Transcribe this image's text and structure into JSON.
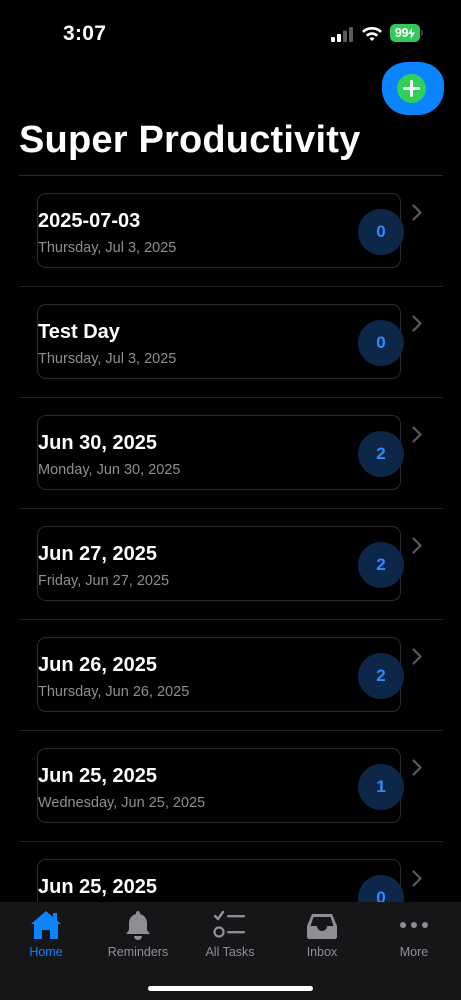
{
  "status_bar": {
    "time": "3:07",
    "battery": "99"
  },
  "header": {
    "title": "Super Productivity"
  },
  "days": [
    {
      "title": "2025-07-03",
      "subtitle": "Thursday, Jul 3, 2025",
      "count": "0"
    },
    {
      "title": "Test Day",
      "subtitle": "Thursday, Jul 3, 2025",
      "count": "0"
    },
    {
      "title": "Jun 30, 2025",
      "subtitle": "Monday, Jun 30, 2025",
      "count": "2"
    },
    {
      "title": "Jun 27, 2025",
      "subtitle": "Friday, Jun 27, 2025",
      "count": "2"
    },
    {
      "title": "Jun 26, 2025",
      "subtitle": "Thursday, Jun 26, 2025",
      "count": "2"
    },
    {
      "title": "Jun 25, 2025",
      "subtitle": "Wednesday, Jun 25, 2025",
      "count": "1"
    },
    {
      "title": "Jun 25, 2025",
      "subtitle": "",
      "count": "0"
    }
  ],
  "tabs": [
    {
      "label": "Home",
      "icon": "house-icon",
      "active": true
    },
    {
      "label": "Reminders",
      "icon": "bell-icon",
      "active": false
    },
    {
      "label": "All Tasks",
      "icon": "checklist-icon",
      "active": false
    },
    {
      "label": "Inbox",
      "icon": "tray-icon",
      "active": false
    },
    {
      "label": "More",
      "icon": "ellipsis-icon",
      "active": false
    }
  ],
  "colors": {
    "accent": "#0a84ff",
    "add": "#30d158",
    "badge_bg": "#0c2748",
    "battery": "#34c759"
  }
}
